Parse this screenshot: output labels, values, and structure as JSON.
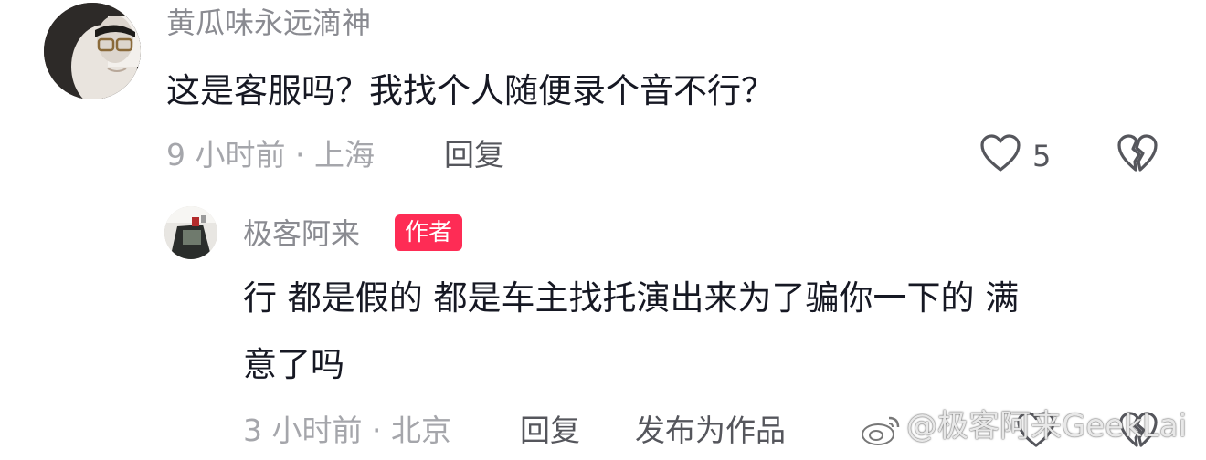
{
  "comment": {
    "username": "黄瓜味永远滴神",
    "text": "这是客服吗？我找个人随便录个音不行？",
    "time_location": "9 小时前 · 上海",
    "reply_label": "回复",
    "like_count": "5"
  },
  "reply": {
    "username": "极客阿来",
    "author_badge": "作者",
    "text_line1": "行 都是假的 都是车主找托演出来为了骗你一下的 满",
    "text_line2": "意了吗",
    "time_location": "3 小时前 · 北京",
    "reply_label": "回复",
    "publish_label": "发布为作品"
  },
  "watermark": {
    "text": "@极客阿来GeekLai"
  },
  "colors": {
    "badge": "#fe2c55",
    "meta": "#a5a6ab",
    "text": "#161823"
  }
}
